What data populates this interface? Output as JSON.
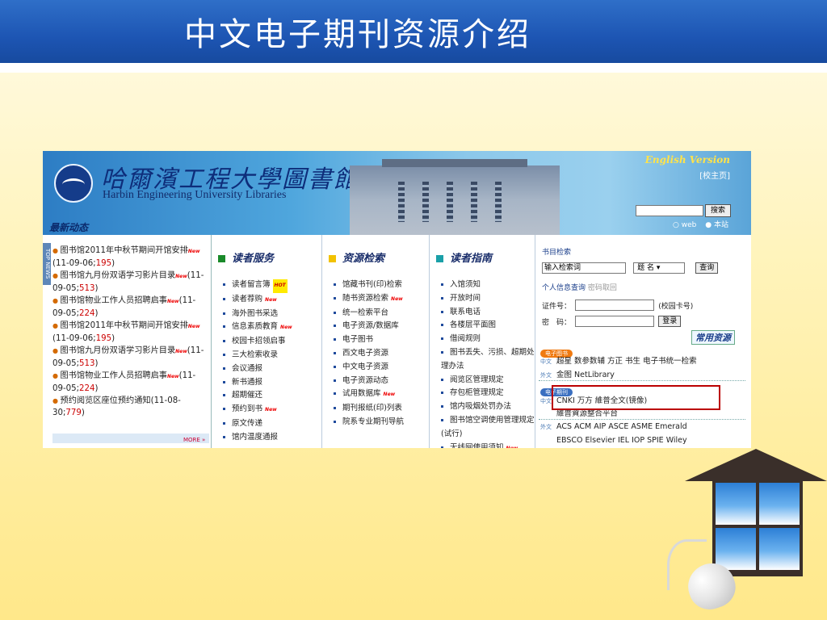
{
  "slide": {
    "title": "中文电子期刊资源介绍"
  },
  "site": {
    "name_cn": "哈爾濱工程大學圖書館",
    "name_en": "Harbin Engineering University Libraries",
    "english_version": "English Version",
    "school_home": "[校主页]",
    "search_button": "搜索",
    "radio_web": "web",
    "radio_site": "本站",
    "news_title": "最新动态",
    "top_news_tab": "TOP NEWS"
  },
  "news": [
    {
      "text": "图书馆2011年中秋节期间开馆安排",
      "date": "(11-09-06;",
      "count": "195",
      "end": ")"
    },
    {
      "text": "图书馆九月份双语学习影片目录",
      "date": "(11-09-05;",
      "count": "513",
      "end": ")"
    },
    {
      "text": "图书馆物业工作人员招聘启事",
      "date": "(11-09-05;",
      "count": "224",
      "end": ")"
    },
    {
      "text": "图书馆2011年中秋节期间开馆安排",
      "date": "(11-09-06;",
      "count": "195",
      "end": ")"
    },
    {
      "text": "图书馆九月份双语学习影片目录",
      "date": "(11-09-05;",
      "count": "513",
      "end": ")"
    },
    {
      "text": "图书馆物业工作人员招聘启事",
      "date": "(11-09-05;",
      "count": "224",
      "end": ")"
    },
    {
      "text": "预约阅览区座位预约通知",
      "date": "(11-08-30;",
      "count": "779",
      "end": ")"
    }
  ],
  "news_more": "MORE »",
  "new_badge": "New",
  "hot_badge": "HOT",
  "columns": [
    {
      "title": "读者服务",
      "color": "#1a8a2a",
      "items": [
        "读者留言簿",
        "读者荐购",
        "海外图书采选",
        "信息素质教育",
        "校园卡招领启事",
        "三大检索收录",
        "会议通报",
        "新书通报",
        "超期催还",
        "预约到书",
        "原文传递",
        "馆内温度通报"
      ]
    },
    {
      "title": "资源检索",
      "color": "#f2c200",
      "items": [
        "馆藏书刊(印)检索",
        "随书资源检索",
        "统一检索平台",
        "电子资源/数据库",
        "电子图书",
        "西文电子资源",
        "中文电子资源",
        "电子资源动态",
        "试用数据库",
        "期刊报纸(印)列表",
        "院系专业期刊导航"
      ]
    },
    {
      "title": "读者指南",
      "color": "#1aa0a8",
      "items": [
        "入馆须知",
        "开放时间",
        "联系电话",
        "各楼层平面图",
        "借阅规则",
        "图书丢失、污损、超期处理办法",
        "阅览区管理规定",
        "存包柜管理规定",
        "馆内吸烟处罚办法",
        "图书馆空调使用管理规定(试行)",
        "无线网使用须知"
      ]
    }
  ],
  "right": {
    "catalog_title": "书目检索",
    "catalog_placeholder": "输入检索词",
    "catalog_select": "题 名",
    "catalog_button": "查询",
    "personal_title": "个人信息查询",
    "password_retrieve": "密码取回",
    "card_label": "证件号：",
    "card_hint": "(校园卡号)",
    "password_label": "密　码：",
    "login_button": "登录",
    "common_resources": "常用资源",
    "ebooks_tag": "电子图书",
    "ejournals_tag": "电子期刊",
    "lang_cn": "中文",
    "lang_en": "外文",
    "ebook_cn": "超星  数参数辅  方正  书生  电子书统一检索",
    "ebook_en": "金图  NetLibrary",
    "journal_cn": "CNKI   万方   維普全文(镜像)",
    "journal_cn2": "維普資源整合平台",
    "journal_en": "ACS  ACM  AIP  ASCE  ASME  Emerald",
    "journal_en2": "EBSCO  Elsevier  IEL  IOP  SPIE  Wiley"
  }
}
